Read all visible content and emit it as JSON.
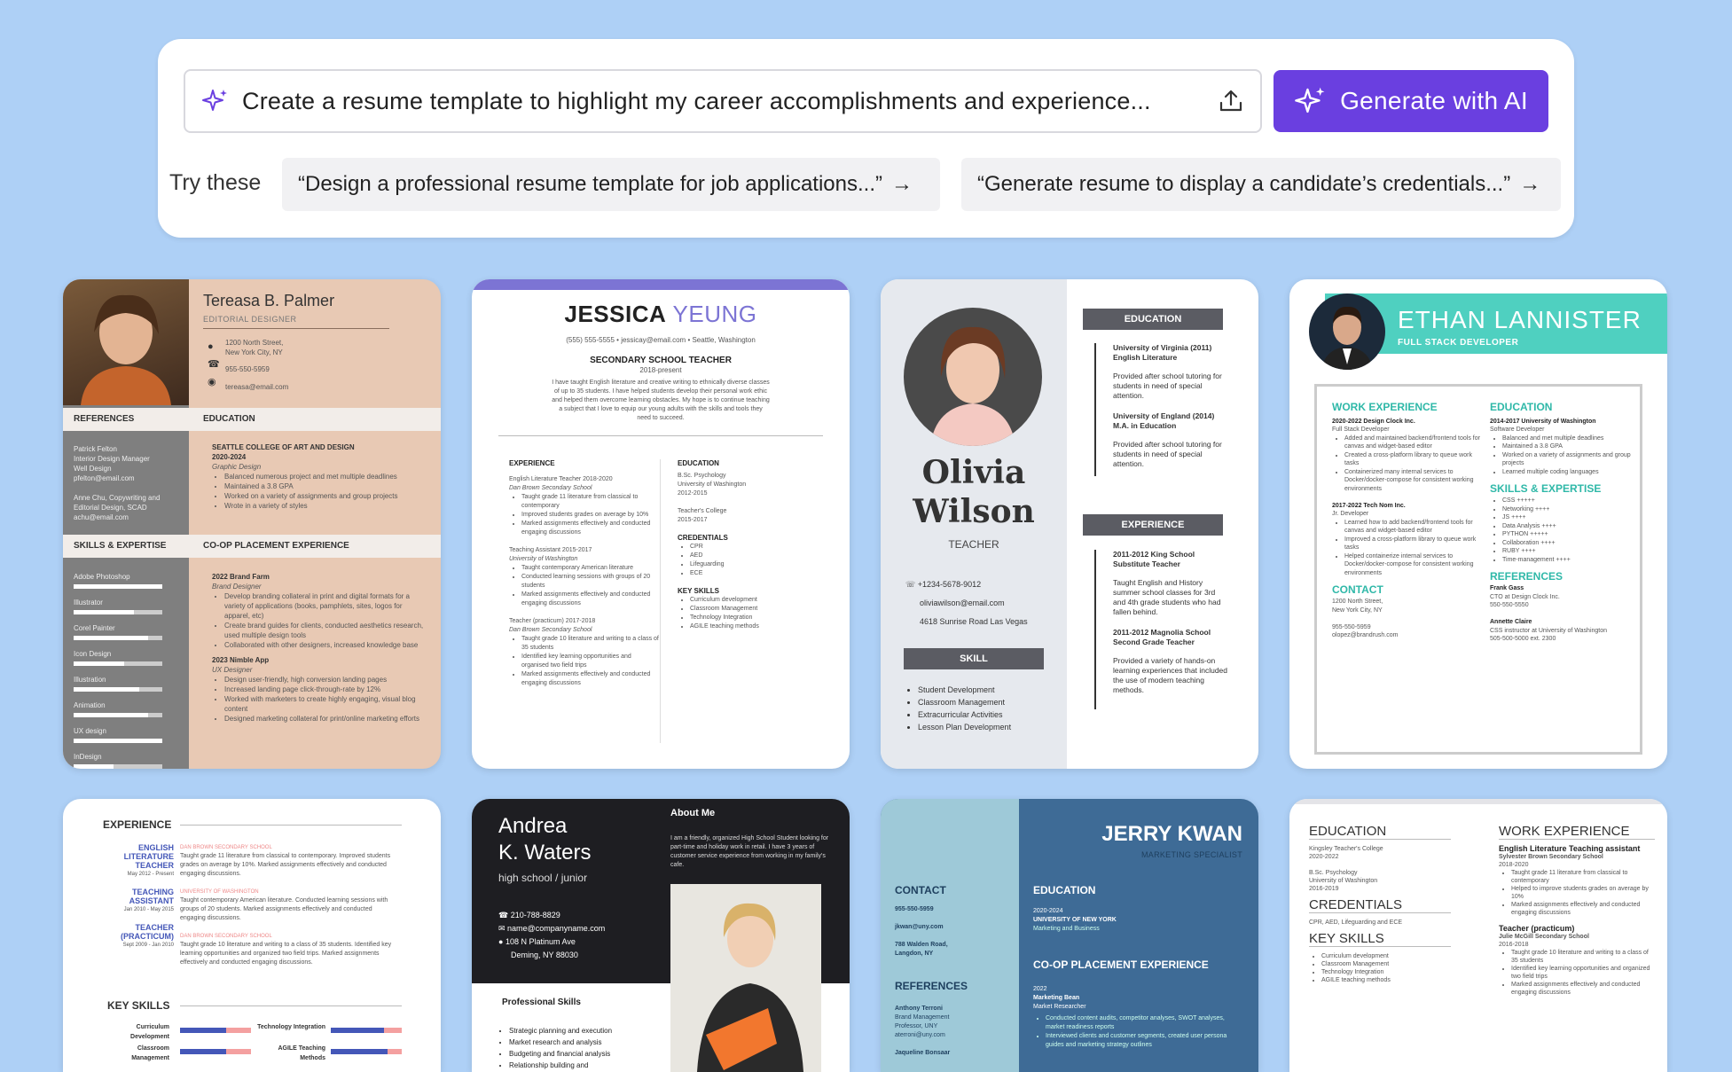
{
  "search": {
    "prompt": "Create a resume template to highlight my career accomplishments and experience...",
    "generate_label": "Generate with AI"
  },
  "suggestions": {
    "label": "Try these",
    "items": [
      "“Design a professional resume template for job applications...”",
      "“Generate resume to display a candidate’s credentials...”"
    ]
  },
  "colors": {
    "background": "#aed0f6",
    "accent": "#6a3fe0"
  },
  "cards": {
    "c1": {
      "name": "Tereasa B. Palmer",
      "role": "EDITORIAL DESIGNER",
      "addr1": "1200 North Street,",
      "addr2": "New York City, NY",
      "phone": "955-550-5959",
      "email": "tereasa@email.com",
      "references": "REFERENCES",
      "education": "EDUCATION",
      "skills": "SKILLS & EXPERTISE",
      "coop": "CO-OP PLACEMENT EXPERIENCE",
      "school": "SEATTLE COLLEGE OF ART AND DESIGN",
      "years": "2020-2024",
      "degree": "Graphic Design",
      "b1": "Balanced numerous project and met multiple deadlines",
      "b2": "Maintained a 3.8 GPA",
      "b3": "Worked on a variety of assignments and group projects",
      "b4": "Wrote in a variety of styles",
      "ref1": "Patrick Felton",
      "ref2": "Interior Design Manager",
      "ref3": "Well Design",
      "ref4": "pfelton@email.com",
      "ref5": "Anne Chu, Copywriting and",
      "ref6": "Editorial Design, SCAD",
      "ref7": "achu@email.com",
      "job1": "2022 Brand Farm",
      "job1r": "Brand Designer",
      "job1b1": "Develop branding collateral in print and digital formats for a variety of applications (books, pamphlets, sites, logos for apparel, etc)",
      "job1b2": "Create brand guides for clients, conducted aesthetics research, used multiple design tools",
      "job1b3": "Collaborated with other designers, increased knowledge base",
      "job2": "2023 Nimble App",
      "job2r": "UX Designer",
      "job2b1": "Design user-friendly, high conversion landing pages",
      "job2b2": "Increased landing page click-through-rate by 12%",
      "job2b3": "Worked with marketers to create highly engaging, visual blog content",
      "job2b4": "Designed marketing collateral for print/online marketing efforts",
      "sk": [
        "Adobe Photoshop",
        "Illustrator",
        "Corel Painter",
        "Icon Design",
        "Illustration",
        "Animation",
        "UX design",
        "InDesign"
      ]
    },
    "c2": {
      "first": "JESSICA",
      "last": "YEUNG",
      "contact": "(555) 555-5555 • jessicay@email.com • Seattle, Washington",
      "title": "SECONDARY SCHOOL TEACHER",
      "years": "2018-present",
      "summary": "I have taught English literature and creative writing to ethnically diverse classes of up to 35 students. I have helped students develop their personal work ethic and helped them overcome learning obstacles. My hope is to continue teaching a subject that I love to equip our young adults with the skills and tools they need to succeed.",
      "exp": "EXPERIENCE",
      "e1": "English Literature Teacher 2018-2020",
      "e1s": "Dan Brown Secondary School",
      "e1b": [
        "Taught grade 11 literature from classical to contemporary",
        "Improved students grades on average by 10%",
        "Marked assignments effectively and conducted engaging discussions"
      ],
      "e2": "Teaching Assistant 2015-2017",
      "e2s": "University of Washington",
      "e2b": [
        "Taught contemporary American literature",
        "Conducted learning sessions with groups of 20 students",
        "Marked assignments effectively and conducted engaging discussions"
      ],
      "e3": "Teacher (practicum) 2017-2018",
      "e3s": "Dan Brown Secondary School",
      "e3b": [
        "Taught grade 10 literature and writing to a class of 35 students",
        "Identified key learning opportunities and organised two field trips",
        "Marked assignments effectively and conducted engaging discussions"
      ],
      "edu": "EDUCATION",
      "ed1": "B.Sc. Psychology",
      "ed2": "University of Washington",
      "ed3": "2012-2015",
      "ed4": "Teacher's College",
      "ed5": "2015-2017",
      "cred": "CREDENTIALS",
      "creds": [
        "CPR",
        "AED",
        "Lifeguarding",
        "ECE"
      ],
      "ks": "KEY SKILLS",
      "skills": [
        "Curriculum development",
        "Classroom Management",
        "Technology Integration",
        "AGILE teaching methods"
      ]
    },
    "c3": {
      "first": "Olivia",
      "last": "Wilson",
      "role": "TEACHER",
      "phone": "+1234-5678-9012",
      "email": "oliviawilson@email.com",
      "addr": "4618 Sunrise Road Las Vegas",
      "skill": "SKILL",
      "skills": [
        "Student Development",
        "Classroom Management",
        "Extracurricular Activities",
        "Lesson Plan Development"
      ],
      "edu": "EDUCATION",
      "ed1": "University of Virginia (2011)",
      "ed1b": "English Literature",
      "ed1d": "Provided after school tutoring for students in need of special attention.",
      "ed2": "University of England (2014)",
      "ed2b": "M.A. in Education",
      "ed2d": "Provided after school tutoring for students in need of special attention.",
      "exp": "EXPERIENCE",
      "x1": "2011-2012 King School",
      "x1b": "Substitute Teacher",
      "x1d": "Taught English and History summer school classes for 3rd and 4th grade students who had fallen behind.",
      "x2": "2011-2012 Magnolia School",
      "x2b": "Second Grade Teacher",
      "x2d": "Provided a variety of hands-on learning experiences that included the use of modern teaching methods."
    },
    "c4": {
      "name": "ETHAN LANNISTER",
      "role": "FULL STACK DEVELOPER",
      "work": "WORK EXPERIENCE",
      "w1": "2020-2022 Design Clock Inc.",
      "w1r": "Full Stack Developer",
      "w1b": [
        "Added and maintained backend/frontend tools for canvas and widget-based editor",
        "Created a cross-platform library to queue work tasks",
        "Containerized many internal services to Docker/docker-compose for consistent working environments"
      ],
      "w2": "2017-2022 Tech Nom Inc.",
      "w2r": "Jr. Developer",
      "w2b": [
        "Learned how to add backend/frontend tools for canvas and widget-based editor",
        "Improved a cross-platform library to queue work tasks",
        "Helped containerize internal services to Docker/docker-compose for consistent working environments"
      ],
      "edu": "EDUCATION",
      "ed1": "2014-2017 University of Washington",
      "ed1r": "Software Developer",
      "ed1b": [
        "Balanced and met multiple deadlines",
        "Maintained a 3.8 GPA",
        "Worked on a variety of assignments and group projects",
        "Learned multiple coding languages"
      ],
      "skills": "SKILLS & EXPERTISE",
      "sk": [
        "CSS +++++",
        "Networking ++++",
        "JS ++++",
        "Data Analysis ++++",
        "PYTHON +++++",
        "Collaboration ++++",
        "RUBY ++++",
        "Time-management ++++"
      ],
      "refs": "REFERENCES",
      "r1": "Frank Gass",
      "r1a": "CTO at Design Clock Inc.",
      "r1b": "550-550-5550",
      "r2": "Annette Claire",
      "r2a": "CSS instructor at University of Washington",
      "r2b": "505-500-5000 ext. 2300",
      "contact": "CONTACT",
      "ct1": "1200 North Street,",
      "ct2": "New York City, NY",
      "ct3": "955-550-5959",
      "ct4": "olopez@brandrush.com"
    },
    "c5": {
      "exp": "EXPERIENCE",
      "j1": "ENGLISH LITERATURE TEACHER",
      "j1d": "May 2012 - Present",
      "j1s": "DAN BROWN SECONDARY SCHOOL",
      "j1t": "Taught grade 11 literature from classical to contemporary. Improved students grades on average by 10%. Marked assignments effectively and conducted engaging discussions.",
      "j2": "TEACHING ASSISTANT",
      "j2d": "Jan 2010 - May 2015",
      "j2s": "UNIVERSITY OF WASHINGTON",
      "j2t": "Taught contemporary American literature. Conducted learning sessions with groups of 20 students. Marked assignments effectively and conducted engaging discussions.",
      "j3": "TEACHER (PRACTICUM)",
      "j3d": "Sept 2009 - Jan 2010",
      "j3s": "DAN BROWN SECONDARY SCHOOL",
      "j3t": "Taught grade 10 literature and writing to a class of 35 students. Identified key learning opportunities and organized two field trips. Marked assignments effectively and conducted engaging discussions.",
      "ks": "KEY SKILLS",
      "k1": "Curriculum Development",
      "k2": "Technology Integration",
      "k3": "Classroom Management",
      "k4": "AGILE Teaching Methods"
    },
    "c6": {
      "first": "Andrea",
      "last": "K. Waters",
      "role": "high school / junior",
      "phone": "210-788-8829",
      "email": "name@companyname.com",
      "addr1": "108 N Platinum Ave",
      "addr2": "Deming, NY 88030",
      "about": "About Me",
      "aboutt": "I am a friendly, organized High School Student looking for part-time and holiday work in retail. I have 3 years of customer service experience from working in my family's cafe.",
      "pskills": "Professional Skills",
      "ps": [
        "Strategic planning and execution",
        "Market research and analysis",
        "Budgeting and financial analysis",
        "Relationship building and"
      ]
    },
    "c7": {
      "name": "JERRY KWAN",
      "role": "MARKETING SPECIALIST",
      "contact": "CONTACT",
      "phone": "955-550-5959",
      "email": "jkwan@uny.com",
      "addr1": "788 Walden Road,",
      "addr2": "Langdon, NY",
      "refs": "REFERENCES",
      "r1": "Anthony Terroni",
      "r1a": "Brand Management",
      "r1b": "Professor, UNY",
      "r1c": "aterroni@uny.com",
      "r2": "Jaqueline Bonsaar",
      "edu": "EDUCATION",
      "ed1": "2020-2024",
      "ed2": "UNIVERSITY OF NEW YORK",
      "ed3": "Marketing and Business",
      "coop": "CO-OP PLACEMENT EXPERIENCE",
      "cp1": "2022",
      "cp2": "Marketing Bean",
      "cp3": "Market Researcher",
      "cpb": [
        "Conducted content audits, competitor analyses, SWOT analyses, market readiness reports",
        "Interviewed clients and customer segments, created user persona guides and marketing strategy outlines"
      ]
    },
    "c8": {
      "edu": "EDUCATION",
      "e1": "Kingsley Teacher's College",
      "e1y": "2020-2022",
      "e2": "B.Sc. Psychology",
      "e2b": "University of Washington",
      "e2y": "2016-2019",
      "cred": "CREDENTIALS",
      "credt": "CPR, AED, Lifeguarding and ECE",
      "ks": "KEY SKILLS",
      "ksl": [
        "Curriculum development",
        "Classroom Management",
        "Technology Integration",
        "AGILE teaching methods"
      ],
      "work": "WORK EXPERIENCE",
      "w1": "English Literature Teaching assistant",
      "w1s": "Sylvester Brown Secondary School",
      "w1y": "2018-2020",
      "w1b": [
        "Taught grade 11 literature from classical to contemporary",
        "Helped to improve students grades on average by 10%",
        "Marked assignments effectively and conducted engaging discussions"
      ],
      "w2": "Teacher (practicum)",
      "w2s": "Julie McGill Secondary School",
      "w2y": "2016-2018",
      "w2b": [
        "Taught grade 10 literature and writing to a class of 35 students",
        "Identified key learning opportunities and organized two field trips",
        "Marked assignments effectively and conducted engaging discussions"
      ]
    }
  }
}
